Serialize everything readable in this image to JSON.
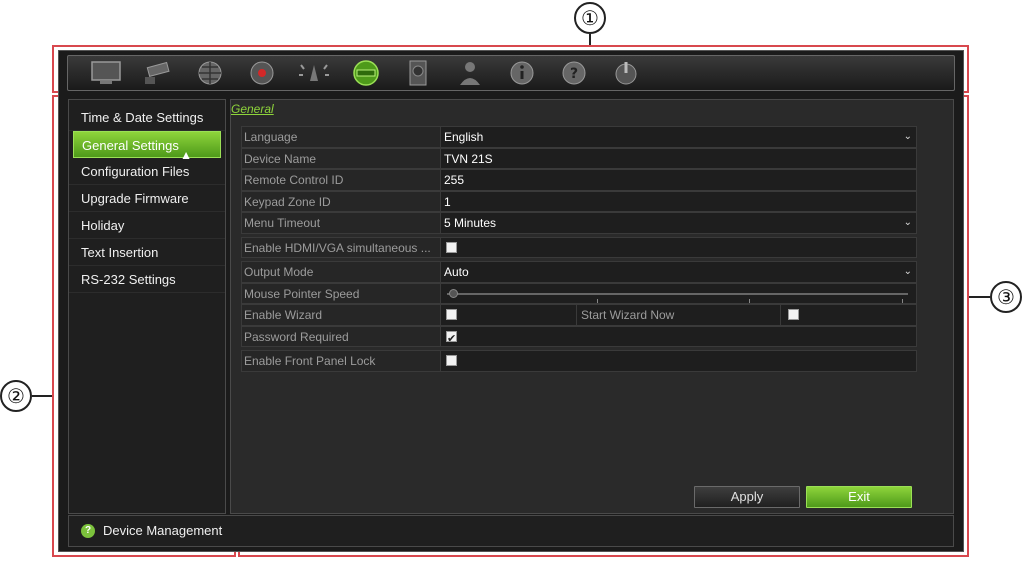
{
  "callouts": [
    "①",
    "②",
    "③"
  ],
  "toolbar": {
    "icons": [
      "monitor-icon",
      "camera-icon",
      "network-icon",
      "record-icon",
      "alarm-icon",
      "device-management-icon",
      "hdd-icon",
      "user-icon",
      "info-icon",
      "help-icon",
      "power-icon"
    ]
  },
  "sidebar": {
    "items": [
      {
        "label": "Time & Date Settings"
      },
      {
        "label": "General Settings"
      },
      {
        "label": "Configuration Files"
      },
      {
        "label": "Upgrade Firmware"
      },
      {
        "label": "Holiday"
      },
      {
        "label": "Text Insertion"
      },
      {
        "label": "RS-232 Settings"
      }
    ],
    "active_index": 1
  },
  "footer": {
    "label": "Device Management"
  },
  "main": {
    "tab": "General",
    "fields": {
      "language": {
        "label": "Language",
        "value": "English"
      },
      "device_name": {
        "label": "Device Name",
        "value": "TVN 21S"
      },
      "remote_control_id": {
        "label": "Remote Control ID",
        "value": "255"
      },
      "keypad_zone_id": {
        "label": "Keypad Zone ID",
        "value": "1"
      },
      "menu_timeout": {
        "label": "Menu Timeout",
        "value": "5 Minutes"
      },
      "enable_hdmi_vga": {
        "label": "Enable HDMI/VGA simultaneous ...",
        "checked": false
      },
      "output_mode": {
        "label": "Output Mode",
        "value": "Auto"
      },
      "mouse_pointer_speed": {
        "label": "Mouse Pointer Speed",
        "level": 0
      },
      "enable_wizard": {
        "label": "Enable Wizard",
        "checked": false
      },
      "start_wizard_now": {
        "label": "Start Wizard Now",
        "checked": false
      },
      "password_required": {
        "label": "Password Required",
        "checked": true
      },
      "enable_front_panel_lock": {
        "label": "Enable Front Panel Lock",
        "checked": false
      }
    },
    "buttons": {
      "apply": "Apply",
      "exit": "Exit"
    }
  },
  "colors": {
    "accent_green": "#7cc23c",
    "callout_red": "#d8484e",
    "background": "#1b1b1b"
  }
}
